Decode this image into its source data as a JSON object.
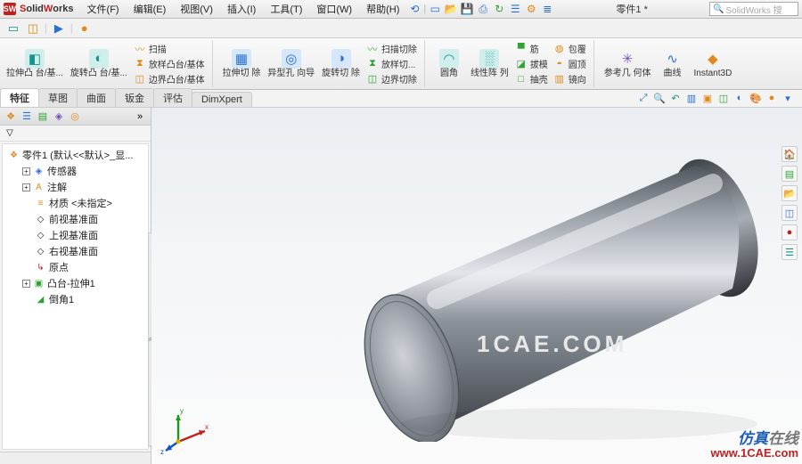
{
  "app": {
    "brand_html": "SolidWorks",
    "doc_name": "零件1 *",
    "search_placeholder": "SolidWorks 搜",
    "menus": [
      {
        "label": "文件(F)"
      },
      {
        "label": "编辑(E)"
      },
      {
        "label": "视图(V)"
      },
      {
        "label": "插入(I)"
      },
      {
        "label": "工具(T)"
      },
      {
        "label": "窗口(W)"
      },
      {
        "label": "帮助(H)"
      }
    ]
  },
  "ribbon": {
    "group1_big": [
      {
        "name": "extruded-boss",
        "label": "拉伸凸\n台/基...",
        "icon": "◧",
        "cls": "c-teal bg-teal"
      },
      {
        "name": "revolved-boss",
        "label": "旋转凸\n台/基...",
        "icon": "◐",
        "cls": "c-teal bg-teal"
      }
    ],
    "group1_col": [
      {
        "name": "swept-boss",
        "label": "扫描",
        "icon": "〰",
        "cls": "c-orange"
      },
      {
        "name": "lofted-boss",
        "label": "放样凸台/基体",
        "icon": "⧗",
        "cls": "c-orange"
      },
      {
        "name": "boundary-boss",
        "label": "边界凸台/基体",
        "icon": "◫",
        "cls": "c-orange"
      }
    ],
    "group2_big": [
      {
        "name": "extruded-cut",
        "label": "拉伸切\n除",
        "icon": "▦",
        "cls": "c-blue bg-blue"
      },
      {
        "name": "hole-wizard",
        "label": "异型孔\n向导",
        "icon": "◎",
        "cls": "c-blue bg-blue"
      },
      {
        "name": "revolved-cut",
        "label": "旋转切\n除",
        "icon": "◑",
        "cls": "c-blue bg-blue"
      }
    ],
    "group2_col": [
      {
        "name": "swept-cut",
        "label": "扫描切除",
        "icon": "〰",
        "cls": "c-green"
      },
      {
        "name": "lofted-cut",
        "label": "放样切...",
        "icon": "⧗",
        "cls": "c-green"
      },
      {
        "name": "boundary-cut",
        "label": "边界切除",
        "icon": "◫",
        "cls": "c-green"
      }
    ],
    "group3_big": [
      {
        "name": "fillet",
        "label": "圆角",
        "icon": "◠",
        "cls": "c-teal bg-teal"
      },
      {
        "name": "linear-pattern",
        "label": "线性阵\n列",
        "icon": "░",
        "cls": "c-teal bg-teal"
      }
    ],
    "group3_col": [
      {
        "name": "rib",
        "label": "筋",
        "icon": "▀",
        "cls": "c-green"
      },
      {
        "name": "draft",
        "label": "拔模",
        "icon": "◪",
        "cls": "c-green"
      },
      {
        "name": "shell",
        "label": "抽壳",
        "icon": "□",
        "cls": "c-green"
      }
    ],
    "group3_col2": [
      {
        "name": "wrap",
        "label": "包覆",
        "icon": "◍",
        "cls": "c-orange"
      },
      {
        "name": "dome",
        "label": "圆顶",
        "icon": "◓",
        "cls": "c-orange"
      },
      {
        "name": "mirror",
        "label": "镜向",
        "icon": "▥",
        "cls": "c-orange"
      }
    ],
    "group4_big": [
      {
        "name": "ref-geometry",
        "label": "参考几\n何体",
        "icon": "✳",
        "cls": "c-purple"
      },
      {
        "name": "curves",
        "label": "曲线",
        "icon": "∿",
        "cls": "c-blue"
      },
      {
        "name": "instant3d",
        "label": "Instant3D",
        "icon": "◆",
        "cls": "c-orange"
      }
    ]
  },
  "tabs": [
    {
      "label": "特征",
      "active": true
    },
    {
      "label": "草图"
    },
    {
      "label": "曲面"
    },
    {
      "label": "钣金"
    },
    {
      "label": "评估"
    },
    {
      "label": "DimXpert"
    }
  ],
  "tree": {
    "root_label": "零件1 (默认<<默认>_显...",
    "nodes": [
      {
        "name": "sensors",
        "icon": "◈",
        "label": "传感器",
        "expandable": true
      },
      {
        "name": "annotations",
        "icon": "A",
        "label": "注解",
        "expandable": true,
        "iconCls": "c-orange"
      },
      {
        "name": "material",
        "icon": "≡",
        "label": "材质 <未指定>",
        "iconCls": "c-orange"
      },
      {
        "name": "front-plane",
        "icon": "◇",
        "label": "前视基准面"
      },
      {
        "name": "top-plane",
        "icon": "◇",
        "label": "上视基准面"
      },
      {
        "name": "right-plane",
        "icon": "◇",
        "label": "右视基准面"
      },
      {
        "name": "origin",
        "icon": "↳",
        "label": "原点",
        "iconCls": "c-red"
      },
      {
        "name": "extrude1",
        "icon": "▣",
        "label": "凸台-拉伸1",
        "expandable": true,
        "iconCls": "c-green"
      },
      {
        "name": "chamfer1",
        "icon": "◢",
        "label": "倒角1",
        "iconCls": "c-green"
      }
    ]
  },
  "axis": {
    "x": "x",
    "y": "y",
    "z": "z"
  },
  "watermark": {
    "center": "1CAE.COM",
    "cn1": "仿真",
    "cn2": "在线",
    "url": "www.1CAE.com"
  }
}
